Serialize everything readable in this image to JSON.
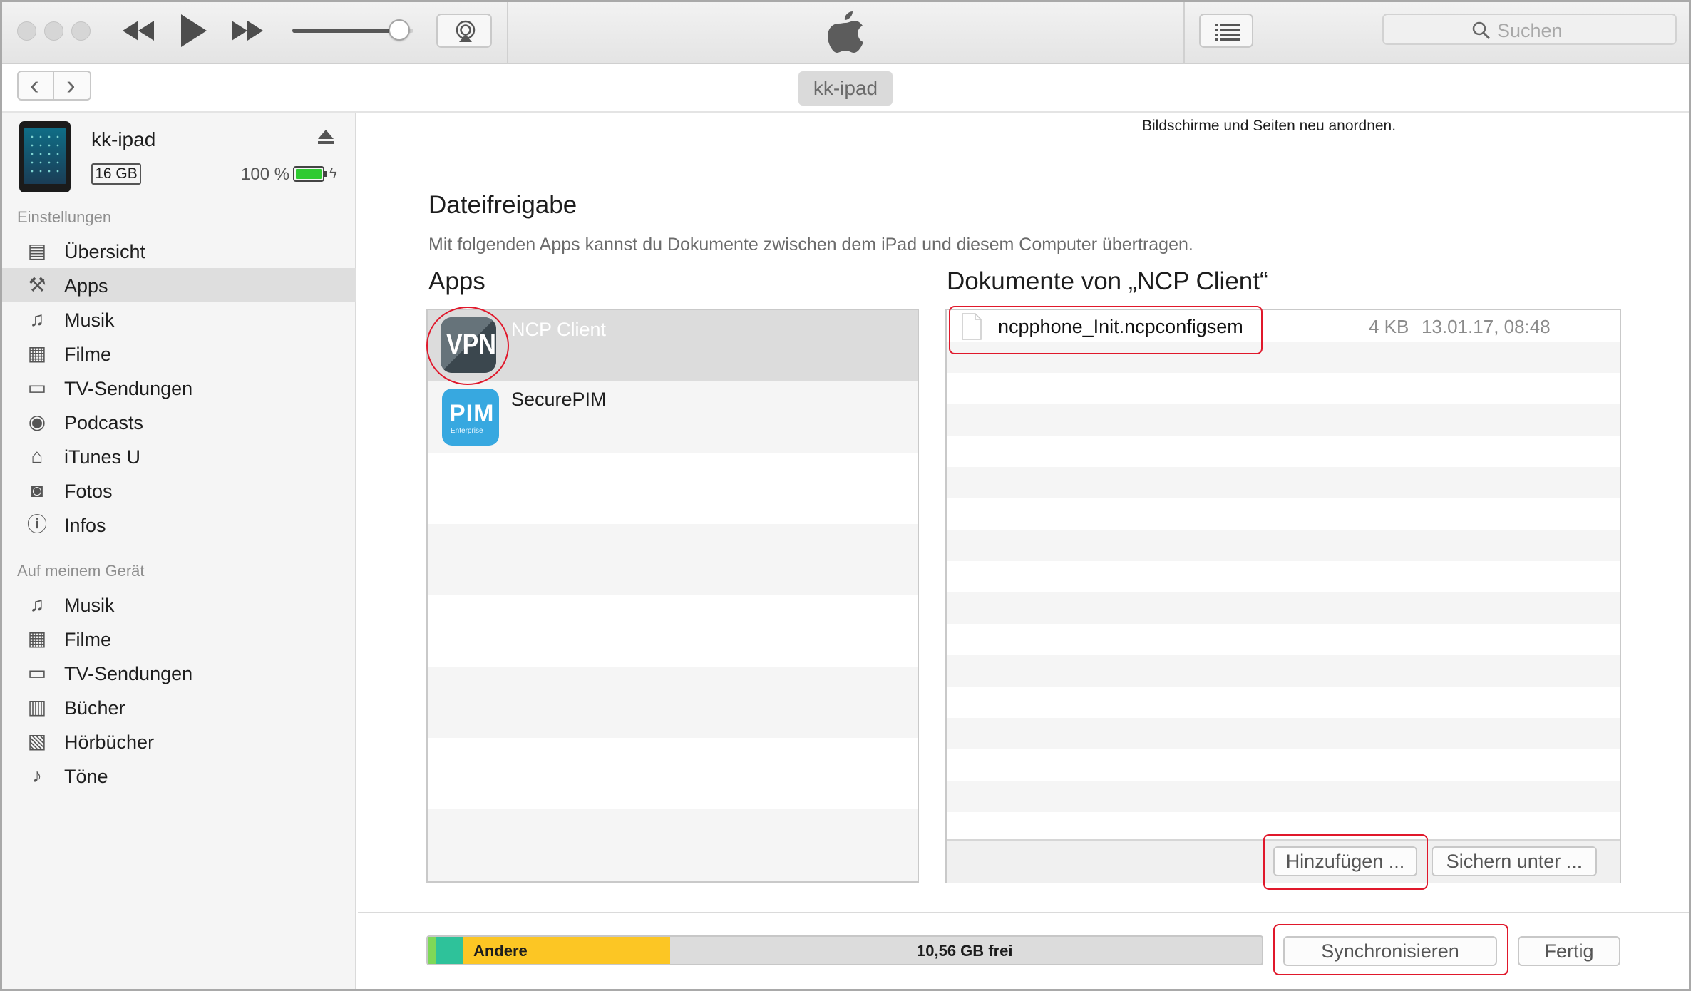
{
  "window": {
    "device_title": "kk-ipad"
  },
  "toolbar": {
    "search_placeholder": "Suchen",
    "icons": [
      "close-light",
      "minimize-light",
      "zoom-light",
      "rewind-icon",
      "play-icon",
      "fast-forward-icon",
      "volume-slider",
      "airplay-icon",
      "apple-logo",
      "list-icon",
      "search-icon"
    ],
    "volume_level": 0.88
  },
  "nav": {
    "back": "‹",
    "forward": "›"
  },
  "device": {
    "name": "kk-ipad",
    "capacity": "16 GB",
    "battery": "100 %",
    "battery_level": 1.0
  },
  "sidebar": {
    "settings_title": "Einstellungen",
    "settings_items": [
      {
        "label": "Übersicht",
        "icon": "summary-icon"
      },
      {
        "label": "Apps",
        "icon": "apps-icon"
      },
      {
        "label": "Musik",
        "icon": "music-note-icon"
      },
      {
        "label": "Filme",
        "icon": "film-icon"
      },
      {
        "label": "TV-Sendungen",
        "icon": "tv-icon"
      },
      {
        "label": "Podcasts",
        "icon": "podcast-icon"
      },
      {
        "label": "iTunes U",
        "icon": "graduation-cap-icon"
      },
      {
        "label": "Fotos",
        "icon": "camera-icon"
      },
      {
        "label": "Infos",
        "icon": "info-icon"
      }
    ],
    "device_title": "Auf meinem Gerät",
    "device_items": [
      {
        "label": "Musik",
        "icon": "music-note-icon"
      },
      {
        "label": "Filme",
        "icon": "film-icon"
      },
      {
        "label": "TV-Sendungen",
        "icon": "tv-icon"
      },
      {
        "label": "Bücher",
        "icon": "book-icon"
      },
      {
        "label": "Hörbücher",
        "icon": "audiobook-icon"
      },
      {
        "label": "Töne",
        "icon": "bell-icon"
      }
    ]
  },
  "main": {
    "top_text": "Bildschirme und Seiten neu anordnen.",
    "title": "Dateifreigabe",
    "subtitle": "Mit folgenden Apps kannst du Dokumente zwischen dem iPad und diesem Computer übertragen.",
    "apps_header": "Apps",
    "apps": [
      {
        "name": "NCP Client",
        "icon_text": "VPN"
      },
      {
        "name": "SecurePIM",
        "icon_text": "PIM",
        "icon_sub": "Enterprise"
      }
    ],
    "docs_header": "Dokumente von „NCP Client“",
    "documents": [
      {
        "name": "ncpphone_Init.ncpconfigsem",
        "size": "4 KB",
        "date": "13.01.17, 08:48"
      }
    ],
    "add_button": "Hinzufügen ...",
    "save_button": "Sichern unter ..."
  },
  "footer": {
    "storage_label": "Andere",
    "free_label": "10,56 GB frei",
    "sync_button": "Synchronisieren",
    "done_button": "Fertig",
    "colors": {
      "green1": "#7ed858",
      "green2": "#2ec29a",
      "yellow": "#fcc624",
      "free": "#dcdcdc"
    }
  }
}
